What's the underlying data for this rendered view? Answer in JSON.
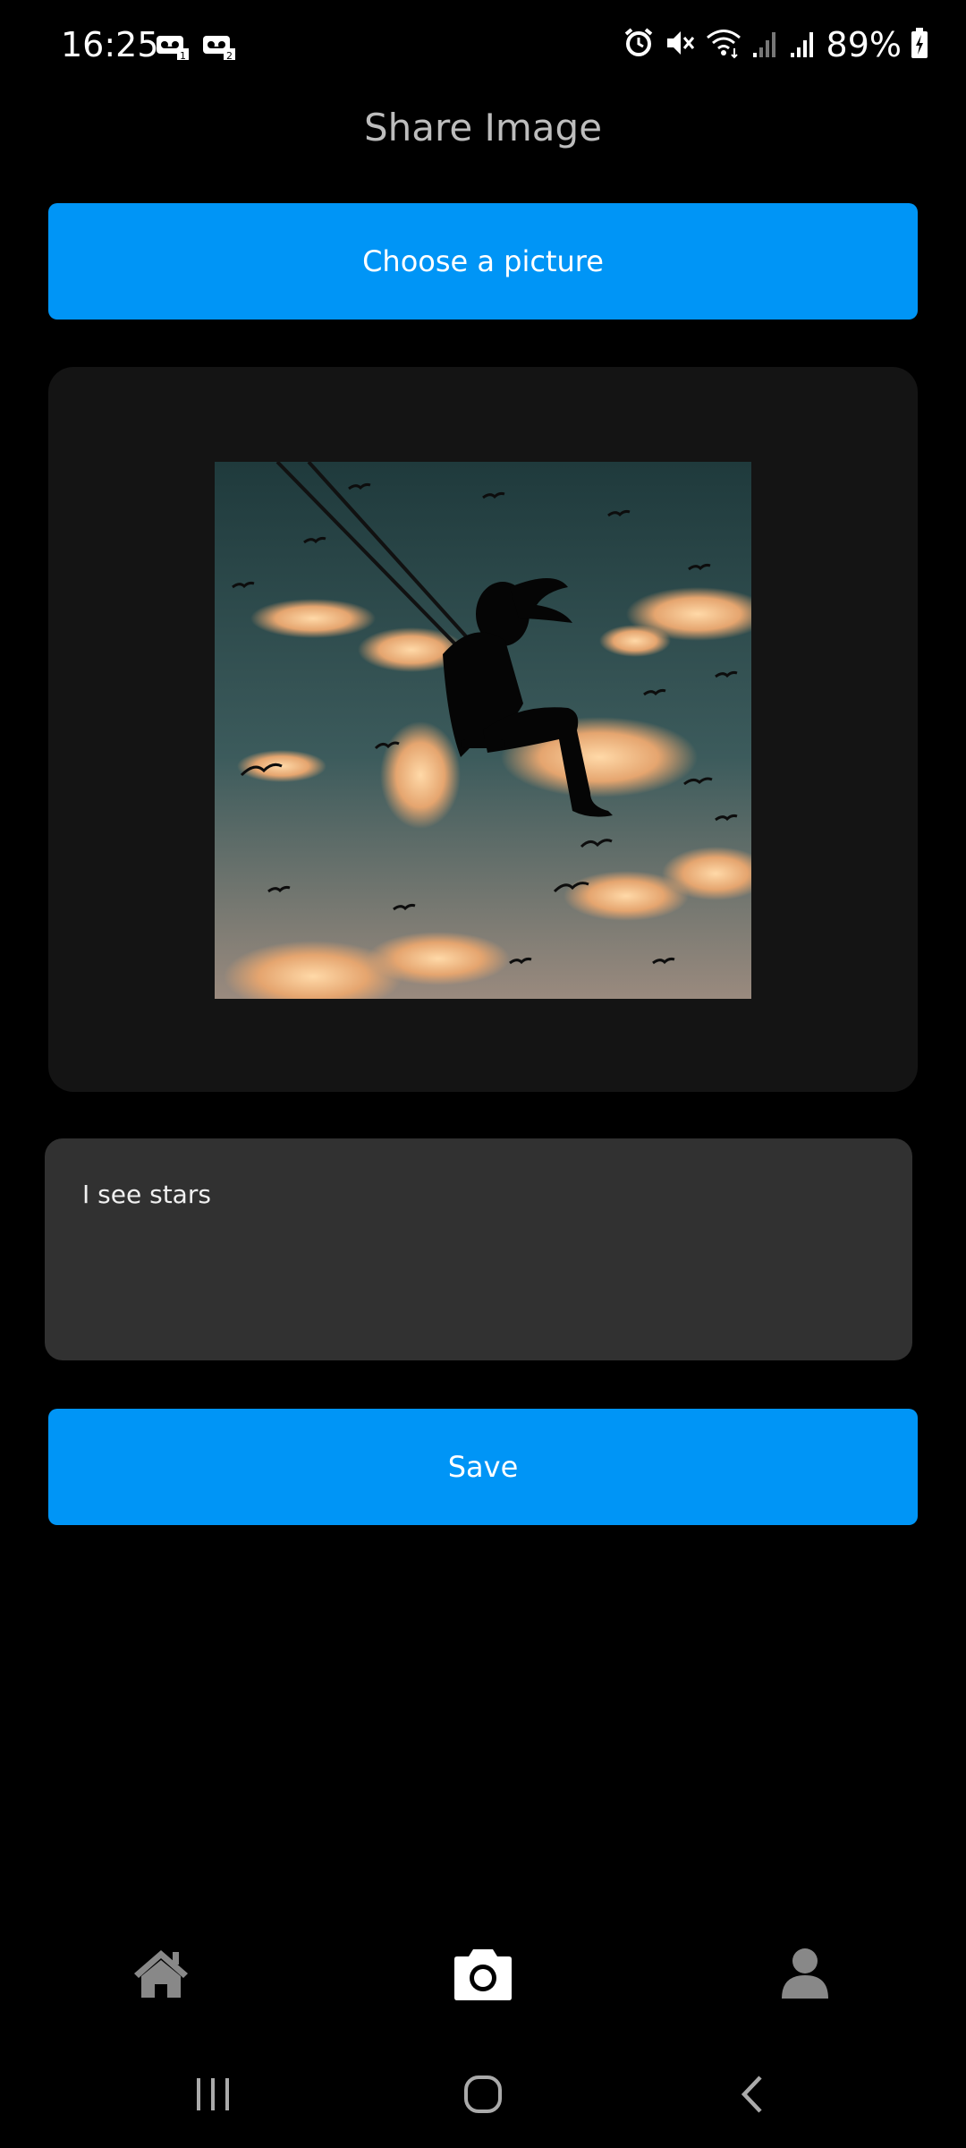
{
  "status_bar": {
    "time": "16:25",
    "battery_percent": "89%",
    "icons": [
      "voicemail-1-icon",
      "voicemail-2-icon",
      "alarm-icon",
      "mute-icon",
      "wifi-icon",
      "signal-1-icon",
      "signal-2-icon",
      "battery-charging-icon"
    ]
  },
  "header": {
    "title": "Share Image"
  },
  "choose_button": {
    "label": "Choose a picture"
  },
  "preview": {
    "image_icon": "swing-silhouette-photo"
  },
  "caption": {
    "value": "I see stars"
  },
  "save_button": {
    "label": "Save"
  },
  "bottom_nav": {
    "items": [
      "home-icon",
      "camera-icon",
      "profile-icon"
    ],
    "active": "camera-icon"
  },
  "system_nav": {
    "items": [
      "recent-apps-icon",
      "home-circle-icon",
      "back-icon"
    ]
  },
  "colors": {
    "accent": "#0095f6",
    "background": "#000000",
    "card": "#141414",
    "input": "#313131"
  }
}
